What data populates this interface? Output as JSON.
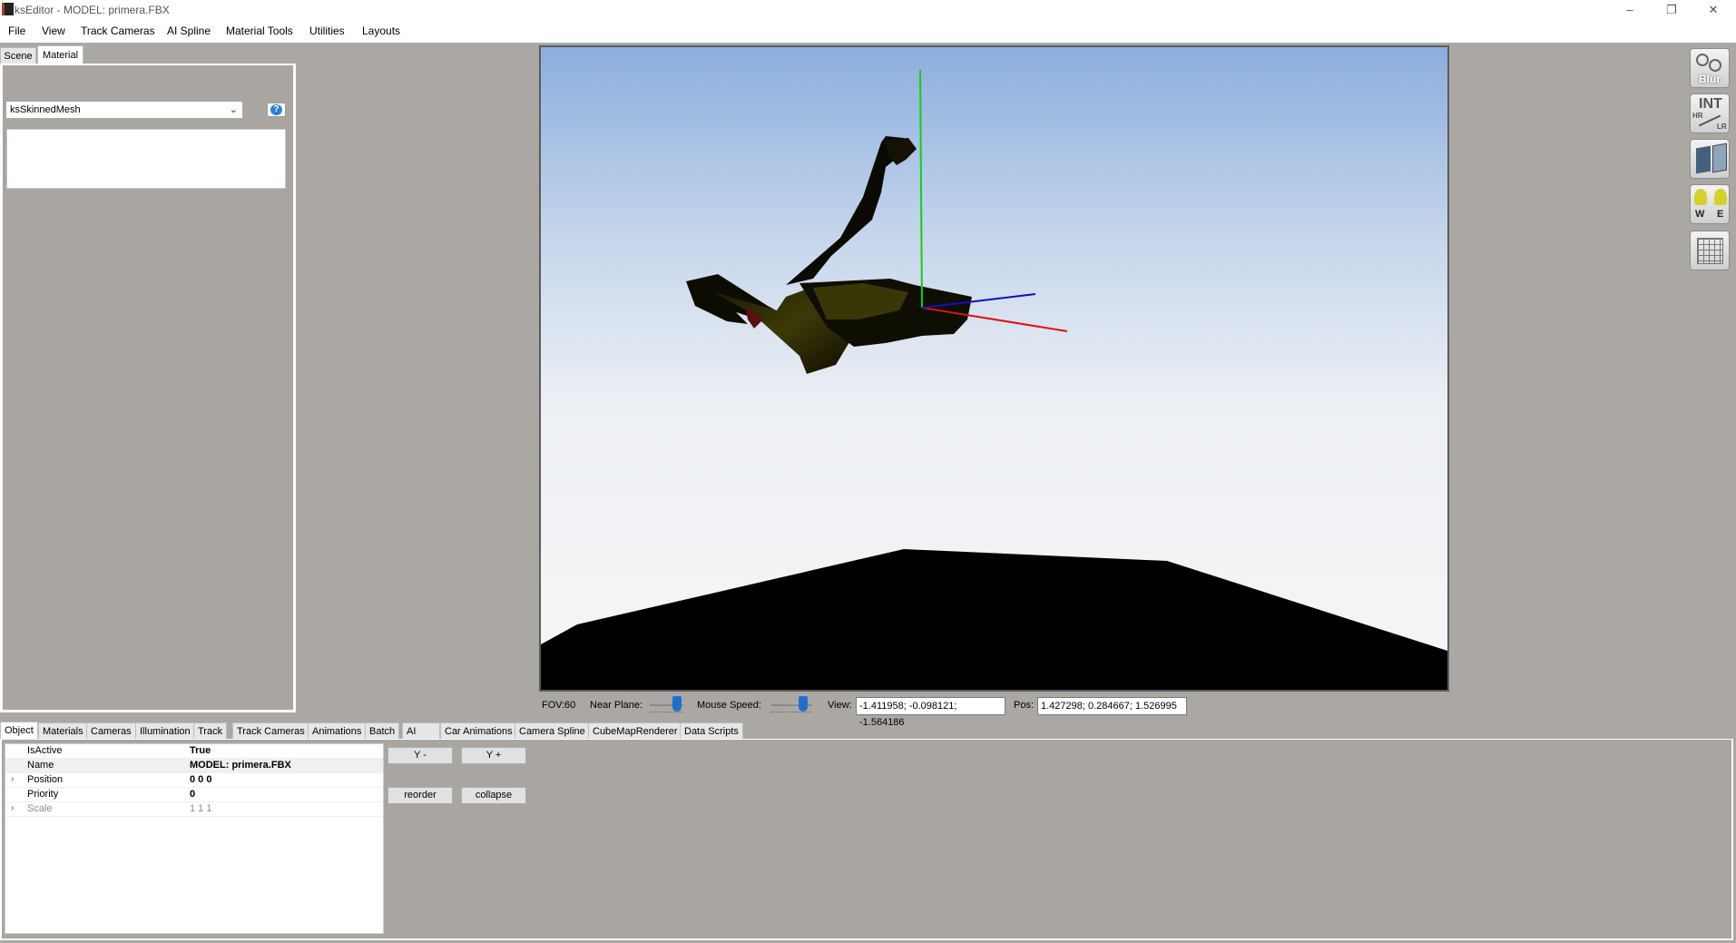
{
  "window": {
    "title": "ksEditor - MODEL: primera.FBX",
    "minimize": "–",
    "restore": "❐",
    "close": "✕"
  },
  "menu": [
    "File",
    "View",
    "Track Cameras",
    "AI Spline",
    "Material Tools",
    "Utilities",
    "Layouts"
  ],
  "left_tabs": {
    "scene": "Scene",
    "material": "Material"
  },
  "material": {
    "shader": "ksSkinnedMesh",
    "help_icon": "?"
  },
  "status": {
    "fov_label": "FOV:",
    "fov_value": "60",
    "near_plane_label": "Near Plane:",
    "near_plane_level": 0.8,
    "mouse_speed_label": "Mouse Speed:",
    "mouse_speed_level": 0.8,
    "view_label": "View:",
    "view_value": "-1.411958; -0.098121; -1.564186",
    "pos_label": "Pos:",
    "pos_value": "1.427298; 0.284667; 1.526995"
  },
  "toolbar": {
    "blur_label": "Blur",
    "int_label": "INT",
    "hr_label": "HR",
    "lr_label": "LR",
    "w_label": "W",
    "e_label": "E"
  },
  "bottom_tabs": [
    "Object",
    "Materials",
    "Cameras",
    "Illumination",
    "Track",
    "Track Cameras",
    "Animations",
    "Batch",
    "AI",
    "Car Animations",
    "Camera Spline",
    "CubeMapRenderer",
    "Data Scripts"
  ],
  "properties": [
    {
      "name": "IsActive",
      "value": "True"
    },
    {
      "name": "Name",
      "value": "MODEL: primera.FBX"
    },
    {
      "name": "Position",
      "value": "0 0 0"
    },
    {
      "name": "Priority",
      "value": "0"
    },
    {
      "name": "Scale",
      "value": "1 1 1"
    }
  ],
  "buttons": {
    "y_minus": "Y -",
    "y_plus": "Y +",
    "reorder": "reorder",
    "collapse": "collapse"
  },
  "colors": {
    "axis_x": "#e01010",
    "axis_y": "#10d010",
    "axis_z": "#1010c0",
    "slider": "#1f6fd1"
  }
}
